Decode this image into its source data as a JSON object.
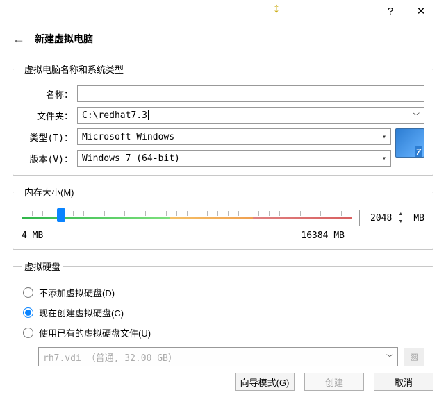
{
  "window": {
    "help": "?",
    "close": "✕",
    "back": "←",
    "title": "新建虚拟电脑"
  },
  "group_name": {
    "legend": "虚拟电脑名称和系统类型",
    "name_label": "名称：",
    "name_value": "",
    "folder_label": "文件夹：",
    "folder_value": "C:\\redhat7.3",
    "type_label": "类型(T)：",
    "type_value": "Microsoft Windows",
    "version_label": "版本(V)：",
    "version_value": "Windows 7 (64-bit)"
  },
  "group_mem": {
    "legend": "内存大小(M)",
    "value": "2048",
    "unit": "MB",
    "min_label": "4 MB",
    "max_label": "16384 MB"
  },
  "group_disk": {
    "legend": "虚拟硬盘",
    "opt_none": "不添加虚拟硬盘(D)",
    "opt_create": "现在创建虚拟硬盘(C)",
    "opt_existing": "使用已有的虚拟硬盘文件(U)",
    "existing_file": "rh7.vdi （普通, 32.00 GB）"
  },
  "footer": {
    "guided": "向导模式(G)",
    "create": "创建",
    "cancel": "取消"
  }
}
